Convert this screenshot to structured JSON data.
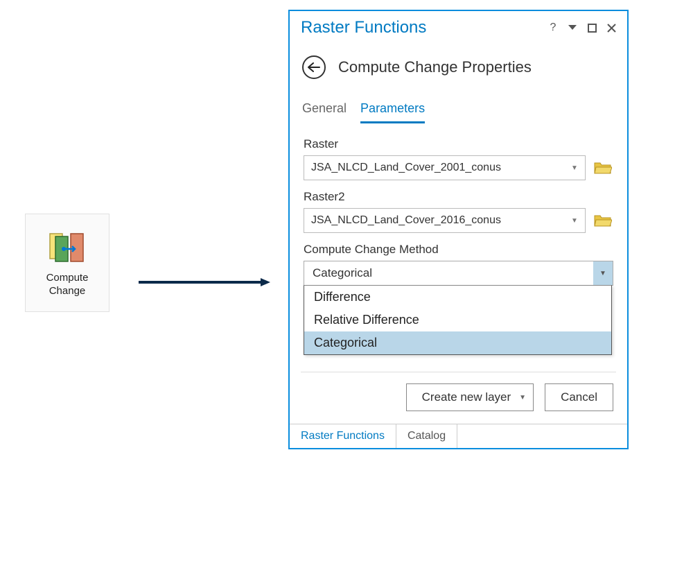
{
  "icon_card": {
    "label_line1": "Compute",
    "label_line2": "Change"
  },
  "panel": {
    "title": "Raster Functions",
    "heading": "Compute Change Properties",
    "tabs": {
      "general": "General",
      "parameters": "Parameters"
    },
    "fields": {
      "raster_label": "Raster",
      "raster_value": "JSA_NLCD_Land_Cover_2001_conus",
      "raster2_label": "Raster2",
      "raster2_value": "JSA_NLCD_Land_Cover_2016_conus",
      "method_label": "Compute Change Method",
      "method_value": "Categorical"
    },
    "method_options": {
      "opt1": "Difference",
      "opt2": "Relative Difference",
      "opt3": "Categorical"
    },
    "actions": {
      "create": "Create new layer",
      "cancel": "Cancel"
    },
    "bottom_tabs": {
      "rf": "Raster Functions",
      "catalog": "Catalog"
    }
  }
}
